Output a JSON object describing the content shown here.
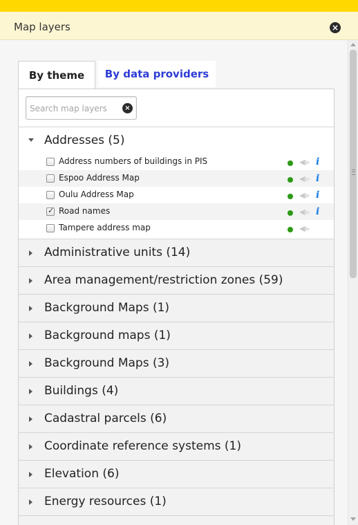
{
  "header": {
    "title": "Map layers",
    "close_icon": "close-icon"
  },
  "tabs": [
    {
      "label": "By theme",
      "active": true
    },
    {
      "label": "By data providers",
      "active": false
    }
  ],
  "search": {
    "placeholder": "Search map layers",
    "value": ""
  },
  "groups": [
    {
      "label": "Addresses (5)",
      "expanded": true,
      "layers": [
        {
          "label": "Address numbers of buildings in PIS",
          "checked": false,
          "status": "green",
          "info": true
        },
        {
          "label": "Espoo Address Map",
          "checked": false,
          "status": "green",
          "info": true
        },
        {
          "label": "Oulu Address Map",
          "checked": false,
          "status": "green",
          "info": true
        },
        {
          "label": "Road names",
          "checked": true,
          "status": "green",
          "info": true
        },
        {
          "label": "Tampere address map",
          "checked": false,
          "status": "green",
          "info": false
        }
      ]
    },
    {
      "label": "Administrative units (14)",
      "expanded": false
    },
    {
      "label": "Area management/restriction zones (59)",
      "expanded": false
    },
    {
      "label": "Background Maps (1)",
      "expanded": false
    },
    {
      "label": "Background maps (1)",
      "expanded": false
    },
    {
      "label": "Background Maps (3)",
      "expanded": false
    },
    {
      "label": "Buildings (4)",
      "expanded": false
    },
    {
      "label": "Cadastral parcels (6)",
      "expanded": false
    },
    {
      "label": "Coordinate reference systems (1)",
      "expanded": false
    },
    {
      "label": "Elevation (6)",
      "expanded": false
    },
    {
      "label": "Energy resources (1)",
      "expanded": false
    },
    {
      "label": "",
      "expanded": false
    }
  ],
  "colors": {
    "topbar": "#ffd800",
    "header_bg": "#fdf6d2",
    "tab_link": "#2c3bd6",
    "status_green": "#2d9a16",
    "info_blue": "#1b7fe6"
  }
}
